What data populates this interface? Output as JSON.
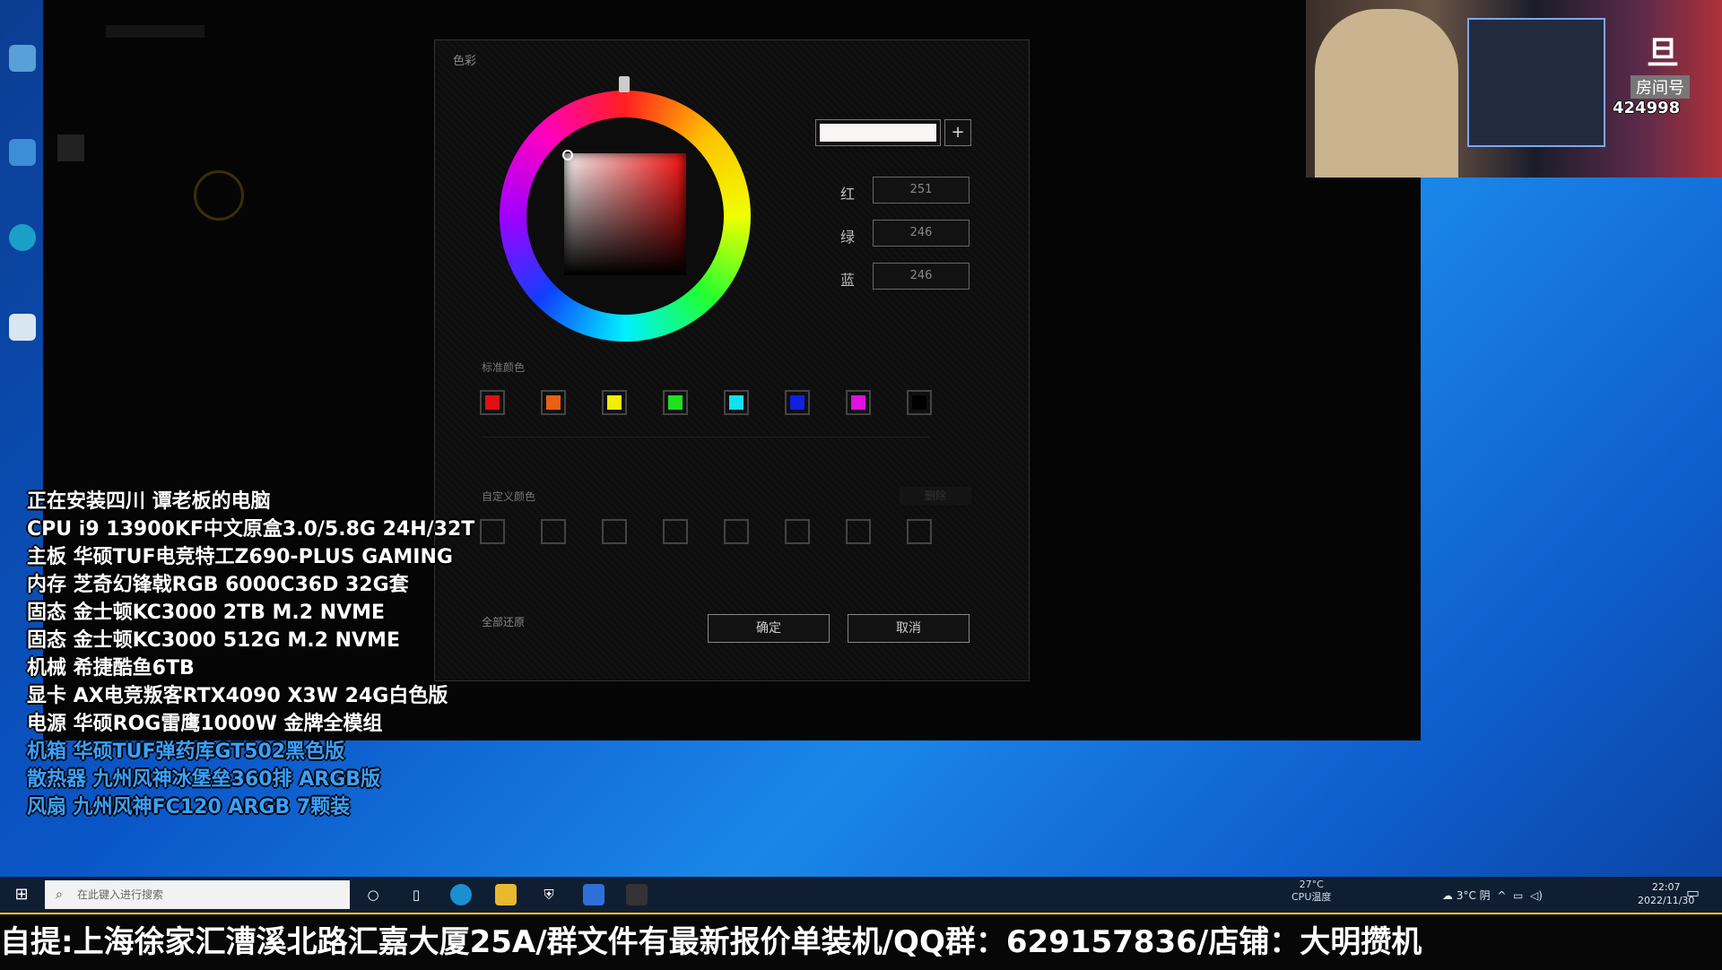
{
  "dialog": {
    "title": "色彩",
    "red_label": "红",
    "green_label": "绿",
    "blue_label": "蓝",
    "red_value": "251",
    "green_value": "246",
    "blue_value": "246",
    "add_label": "+",
    "standard_colors_label": "标准颜色",
    "custom_colors_label": "自定义颜色",
    "delete_label": "删除",
    "restore_label": "全部还原",
    "ok_label": "确定",
    "cancel_label": "取消",
    "preview_color": "#fbf6f6",
    "standard_colors": [
      "#e01010",
      "#e86010",
      "#f0f000",
      "#20e020",
      "#10e0f0",
      "#1020e0",
      "#e010e0",
      "#000000"
    ]
  },
  "specs": [
    "正在安装四川 谭老板的电脑",
    "CPU i9 13900KF中文原盒3.0/5.8G 24H/32T",
    "主板 华硕TUF电竞特工Z690-PLUS GAMING",
    "内存 芝奇幻锋戟RGB 6000C36D 32G套",
    "固态 金士顿KC3000 2TB M.2    NVME",
    "固态 金士顿KC3000 512G M.2 NVME",
    "机械 希捷酷鱼6TB",
    "显卡 AX电竞叛客RTX4090 X3W 24G白色版",
    "电源 华硕ROG雷鹰1000W 金牌全模组",
    "机箱 华硕TUF弹药库GT502黑色版",
    "散热器 九州风神冰堡垒360排 ARGB版",
    "风扇 九州风神FC120 ARGB 7颗装"
  ],
  "webcam": {
    "counter": "424998",
    "room_label": "房间号",
    "logo": "旦"
  },
  "taskbar": {
    "search_placeholder": "在此键入进行搜索",
    "cpu_temp_value": "27°C",
    "cpu_temp_label": "CPU温度",
    "weather": "3°C 阴",
    "time": "22:07",
    "date": "2022/11/30"
  },
  "banner": {
    "text": "自提:上海徐家汇漕溪北路汇嘉大厦25A/群文件有最新报价单装机/QQ群：629157836/店铺：大明攒机"
  }
}
